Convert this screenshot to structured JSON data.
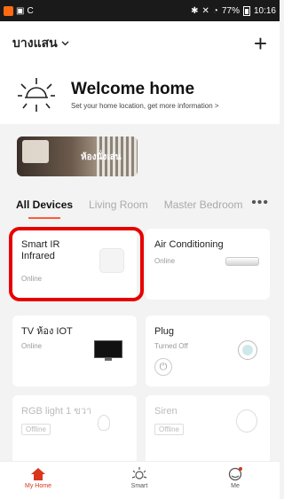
{
  "statusbar": {
    "right_text": "77%",
    "time": "10:16"
  },
  "header": {
    "home_name": "บางแสน",
    "add_icon": "plus"
  },
  "welcome": {
    "title": "Welcome home",
    "subtitle": "Set your home location, get more information >"
  },
  "room_card": {
    "label": "ห้องนั่งเล่น"
  },
  "tabs": {
    "items": [
      "All Devices",
      "Living Room",
      "Master Bedroom"
    ],
    "active": "All Devices",
    "more": "•••"
  },
  "devices": [
    {
      "name": "Smart IR Infrared",
      "status": "Online"
    },
    {
      "name": "Air Conditioning",
      "status": "Online"
    },
    {
      "name": "TV ห้อง IOT",
      "status": "Online"
    },
    {
      "name": "Plug",
      "status": "Turned Off"
    },
    {
      "name": "RGB light 1 ขวา",
      "status": "Offline"
    },
    {
      "name": "Siren",
      "status": "Offline"
    }
  ],
  "nav": {
    "home": "My Home",
    "smart": "Smart",
    "me": "Me"
  },
  "colors": {
    "accent": "#d9361c",
    "highlight": "#e60000"
  }
}
